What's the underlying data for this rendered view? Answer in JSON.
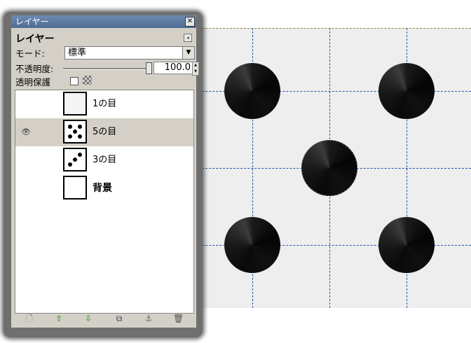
{
  "window": {
    "title": "レイヤー",
    "close_glyph": "✕"
  },
  "panel": {
    "heading": "レイヤー",
    "menu_glyph": "◂",
    "mode_label": "モード:",
    "mode_value": "標準",
    "opacity_label": "不透明度:",
    "opacity_value": "100.0",
    "opacity_level": 1.0,
    "lock_alpha_label": "透明保護",
    "lock_alpha_checked": false
  },
  "layers": [
    {
      "name": "1の目",
      "visible": false,
      "active": false,
      "dots": 0
    },
    {
      "name": "5の目",
      "visible": true,
      "active": true,
      "dots": 5
    },
    {
      "name": "3の目",
      "visible": false,
      "active": false,
      "dots": 3
    },
    {
      "name": "背景",
      "visible": false,
      "active": false,
      "dots": 0
    }
  ],
  "toolbar": [
    {
      "icon": "new-layer-icon",
      "glyph": "🗋"
    },
    {
      "icon": "raise-layer-icon",
      "glyph": "⇧"
    },
    {
      "icon": "lower-layer-icon",
      "glyph": "⇩"
    },
    {
      "icon": "duplicate-layer-icon",
      "glyph": "⧉"
    },
    {
      "icon": "anchor-layer-icon",
      "glyph": "⚓"
    },
    {
      "icon": "delete-layer-icon",
      "glyph": "🗑"
    }
  ],
  "colors": {
    "guide": "#2255aa",
    "canvas_bg": "#eeeeee",
    "titlebar": "#5d7aa0",
    "active_row": "#d4d0c8",
    "raise_lower_arrow": "#3aa83a"
  }
}
